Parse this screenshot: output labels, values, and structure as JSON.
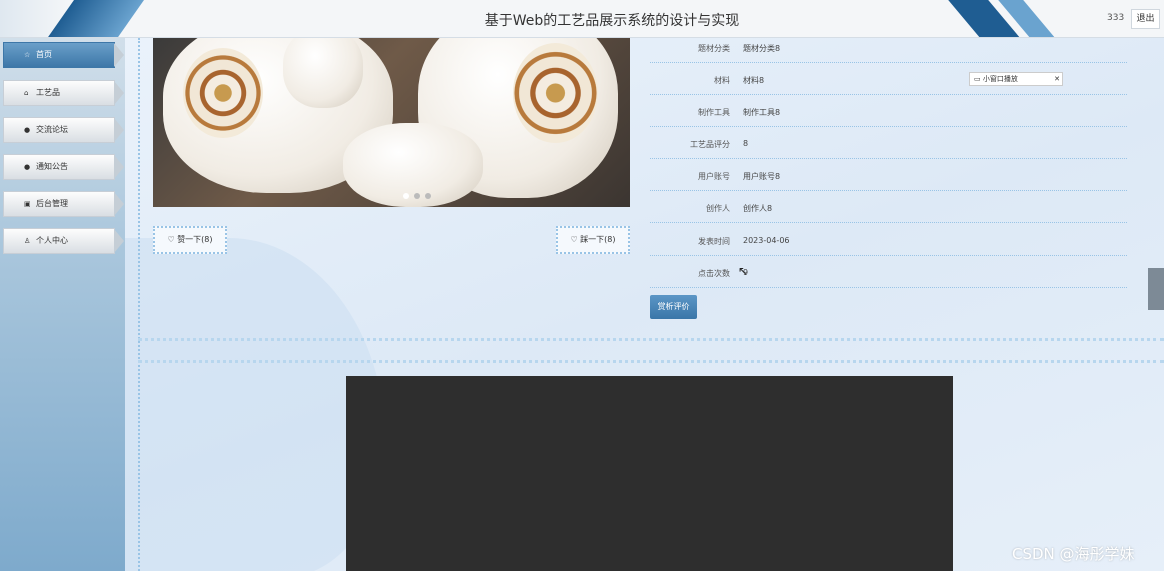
{
  "header": {
    "title": "基于Web的工艺品展示系统的设计与实现",
    "user": "333",
    "logout_label": "退出"
  },
  "sidebar": {
    "items": [
      {
        "label": "首页",
        "icon": "star-icon",
        "glyph": "☆"
      },
      {
        "label": "工艺品",
        "icon": "bag-icon",
        "glyph": "⌂"
      },
      {
        "label": "交流论坛",
        "icon": "info-icon",
        "glyph": "●"
      },
      {
        "label": "通知公告",
        "icon": "info-icon",
        "glyph": "●"
      },
      {
        "label": "后台管理",
        "icon": "briefcase-icon",
        "glyph": "▣"
      },
      {
        "label": "个人中心",
        "icon": "user-icon",
        "glyph": "♙"
      }
    ]
  },
  "actions": {
    "like_label": "赞一下(8)",
    "dislike_label": "踩一下(8)",
    "review_label": "赏析评价"
  },
  "details": [
    {
      "label": "题材分类",
      "value": "题材分类8"
    },
    {
      "label": "材料",
      "value": "材料8"
    },
    {
      "label": "制作工具",
      "value": "制作工具8"
    },
    {
      "label": "工艺品评分",
      "value": "8"
    },
    {
      "label": "用户账号",
      "value": "用户账号8"
    },
    {
      "label": "创作人",
      "value": "创作人8"
    },
    {
      "label": "发表时间",
      "value": "2023-04-06"
    },
    {
      "label": "点击次数",
      "value": "9"
    }
  ],
  "mini_window": {
    "label": "小窗口播放",
    "close": "✕"
  },
  "watermark": "CSDN @海彤学妹",
  "colors": {
    "accent": "#3d77a8",
    "dotted": "#99c4e6"
  }
}
